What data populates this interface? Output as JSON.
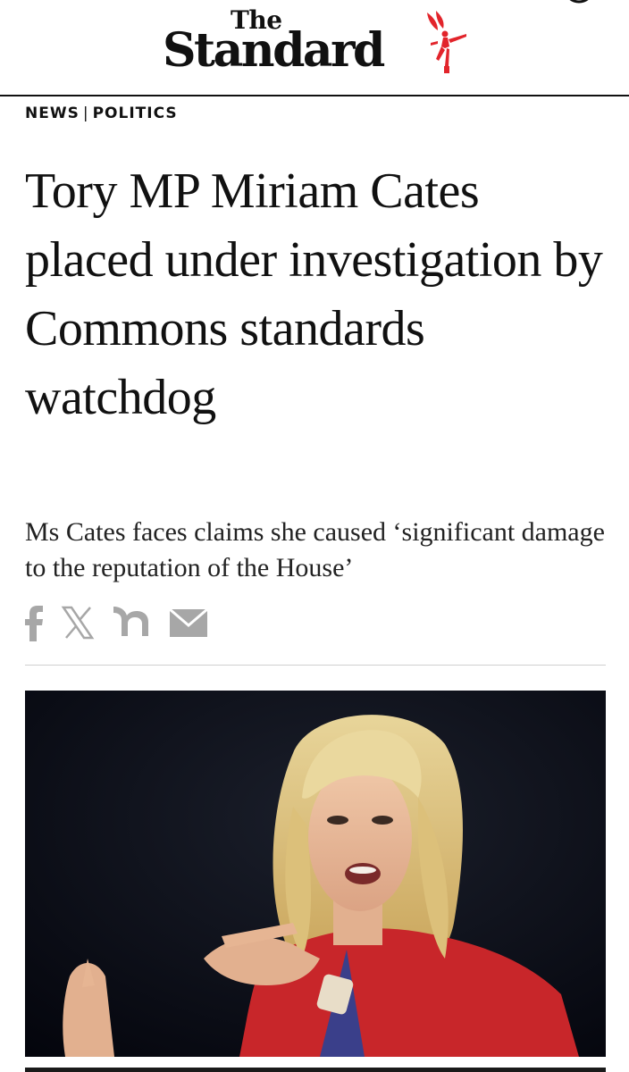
{
  "brand": {
    "the": "The",
    "name": "Standard"
  },
  "colors": {
    "brand_red": "#e2242b",
    "share_grey": "#a7a7a7",
    "divider": "#cfcfcf"
  },
  "breadcrumb": {
    "section": "NEWS",
    "separator": "|",
    "subsection": "POLITICS"
  },
  "article": {
    "headline": "Tory MP Miriam Cates placed under investigation by Commons standards watchdog",
    "standfirst": "Ms Cates faces claims she caused ‘significant damage to the reputation of the House’"
  },
  "share": [
    {
      "icon": "facebook-icon"
    },
    {
      "icon": "x-icon"
    },
    {
      "icon": "nextdoor-icon"
    },
    {
      "icon": "email-icon"
    }
  ],
  "hero_image": {
    "subject": "photo of woman with blonde wavy hair in red jacket gesturing while speaking"
  }
}
